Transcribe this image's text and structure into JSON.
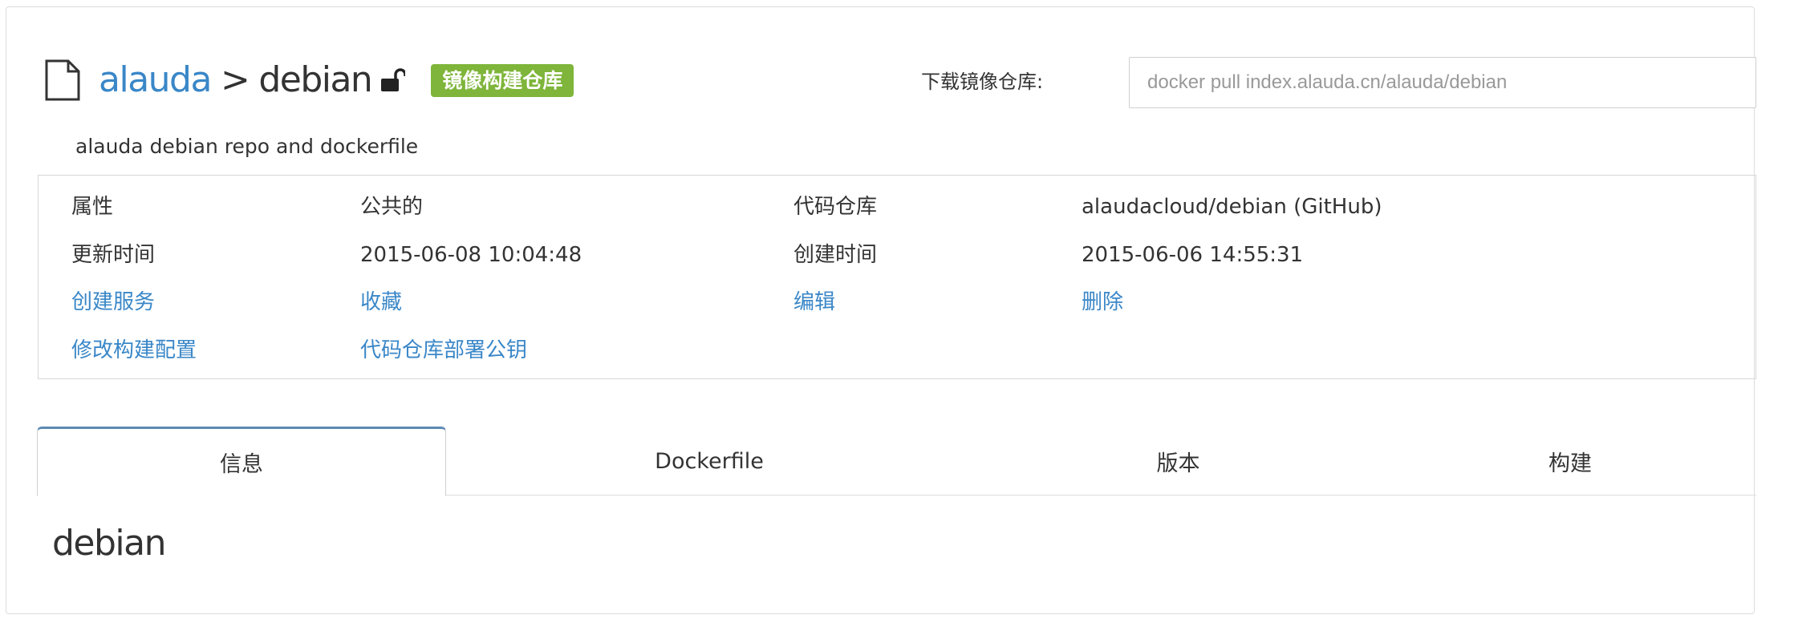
{
  "header": {
    "owner_link": "alauda",
    "separator": ">",
    "repo_name": "debian",
    "badge": "镜像构建仓库",
    "file_icon": "file-icon",
    "lock_icon": "unlock-icon"
  },
  "pull": {
    "label": "下载镜像仓库:",
    "command": "docker pull index.alauda.cn/alauda/debian"
  },
  "description": "alauda debian repo and dockerfile",
  "details": {
    "property_label": "属性",
    "property_value": "公共的",
    "code_repo_label": "代码仓库",
    "code_repo_value": "alaudacloud/debian (GitHub)",
    "updated_label": "更新时间",
    "updated_value": "2015-06-08 10:04:48",
    "created_label": "创建时间",
    "created_value": "2015-06-06 14:55:31"
  },
  "actions": {
    "create_service": "创建服务",
    "favorite": "收藏",
    "edit": "编辑",
    "delete": "删除",
    "modify_build_config": "修改构建配置",
    "deploy_key": "代码仓库部署公钥"
  },
  "tabs": [
    {
      "label": "信息"
    },
    {
      "label": "Dockerfile"
    },
    {
      "label": "版本"
    },
    {
      "label": "构建"
    }
  ],
  "content": {
    "title": "debian"
  },
  "colors": {
    "link": "#3a87c8",
    "badge": "#7eb53a",
    "active_tab_top": "#5b8ab3"
  }
}
